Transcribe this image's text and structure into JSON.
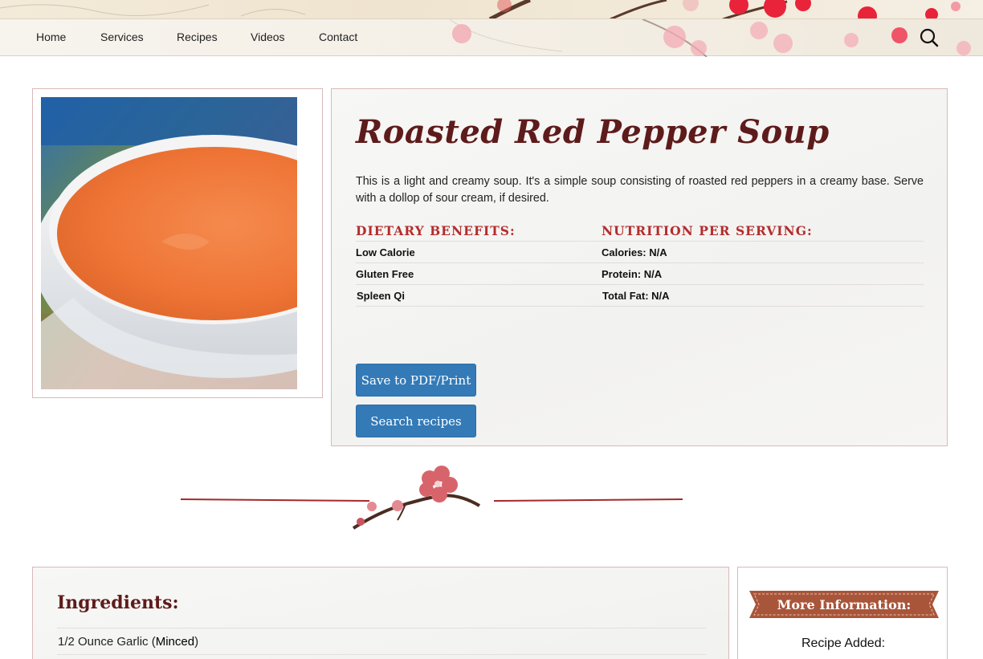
{
  "nav": {
    "items": [
      "Home",
      "Services",
      "Recipes",
      "Videos",
      "Contact"
    ],
    "search_icon": "search-icon"
  },
  "recipe": {
    "title": "Roasted Red Pepper Soup",
    "description": "This is a light and creamy soup. It's a simple soup consisting of roasted red peppers in a creamy base. Serve with a dollop of sour cream, if desired.",
    "dietary_heading": "DIETARY BENEFITS:",
    "dietary": [
      "Low Calorie",
      "Gluten Free",
      "Spleen Qi"
    ],
    "nutrition_heading": "NUTRITION PER SERVING:",
    "nutrition": [
      "Calories: N/A",
      "Protein: N/A",
      "Total Fat: N/A"
    ],
    "save_button": "Save to PDF/Print",
    "search_button": "Search recipes"
  },
  "ingredients": {
    "title": "Ingredients:",
    "first_item": {
      "text": "1/2 Ounce Garlic (",
      "prep": "Minced",
      "close": ")"
    }
  },
  "more_info": {
    "title": "More Information:",
    "recipe_added_label": "Recipe Added:"
  },
  "colors": {
    "accent": "#b32d2d",
    "title": "#5e1b1b",
    "button": "#337ab7",
    "border": "#d9b9b9"
  }
}
